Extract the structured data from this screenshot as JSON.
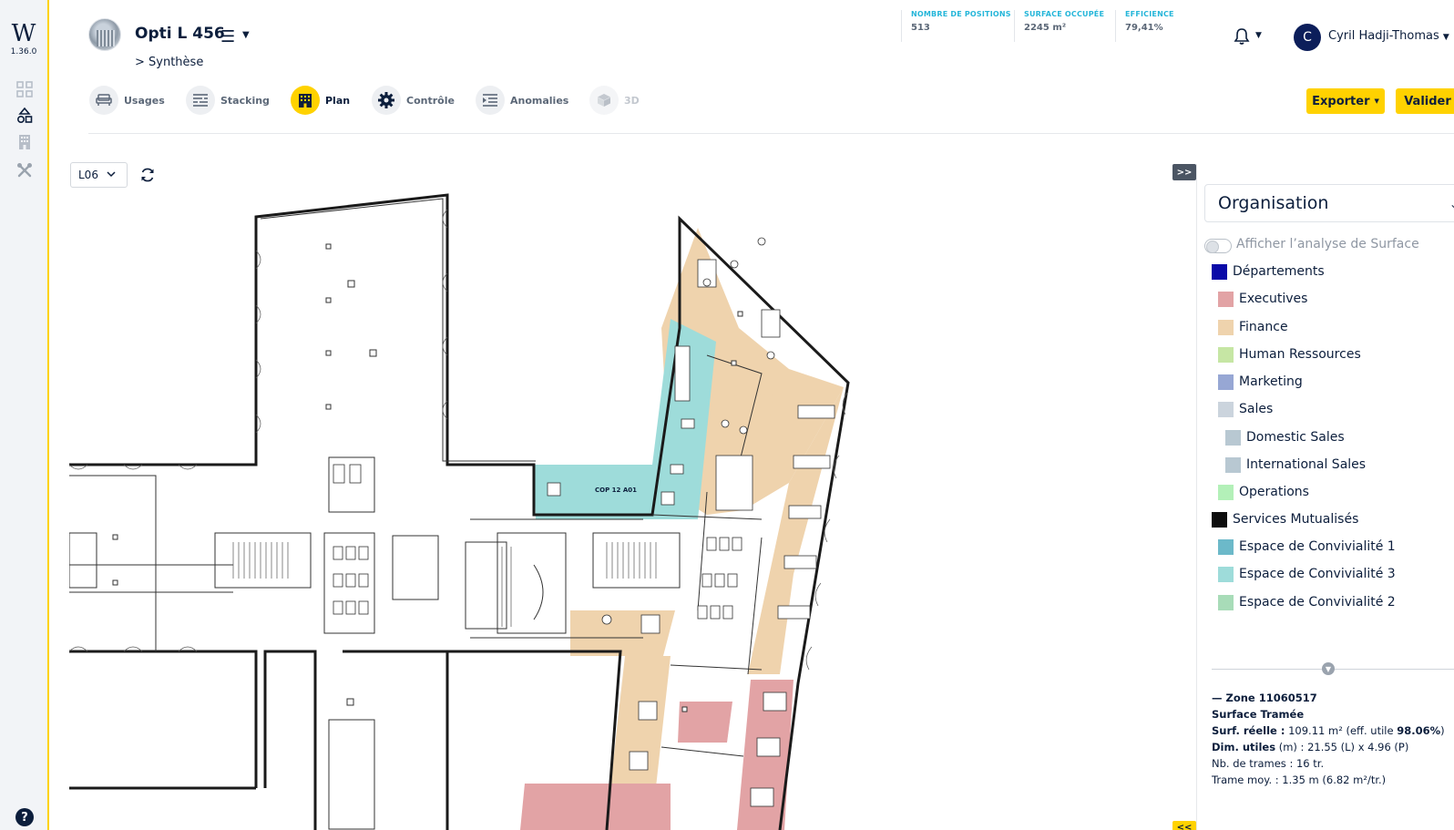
{
  "app": {
    "logo_letter": "W",
    "version": "1.36.0",
    "help_label": "?"
  },
  "project": {
    "title": "Opti L 456",
    "breadcrumb": "> Synthèse"
  },
  "kpis": [
    {
      "label": "NOMBRE DE POSITIONS",
      "value": "513"
    },
    {
      "label": "SURFACE OCCUPÉE",
      "value": "2245 m²"
    },
    {
      "label": "EFFICIENCE",
      "value": "79,41%"
    }
  ],
  "user": {
    "initial": "C",
    "name": "Cyril Hadji-Thomas"
  },
  "tabs": [
    {
      "label": "Usages",
      "icon": "sofa-icon"
    },
    {
      "label": "Stacking",
      "icon": "stacking-icon"
    },
    {
      "label": "Plan",
      "icon": "building-icon"
    },
    {
      "label": "Contrôle",
      "icon": "gear-icon"
    },
    {
      "label": "Anomalies",
      "icon": "list-indent-icon"
    },
    {
      "label": "3D",
      "icon": "cube-icon"
    }
  ],
  "actions": {
    "export_label": "Exporter",
    "validate_label": "Valider"
  },
  "floor": {
    "selected": "L06"
  },
  "plan": {
    "room_label": "COP 12 A01"
  },
  "panel": {
    "collapse_right": ">>",
    "collapse_bottom": "<<",
    "organisation": "Organisation",
    "toggle_label": "Afficher l’analyse de Surface",
    "legend": [
      {
        "label": "Départements",
        "color": "#0a0aa8"
      },
      {
        "label": "Executives",
        "color": "#e2a3a5"
      },
      {
        "label": "Finance",
        "color": "#efd3ad"
      },
      {
        "label": "Human Ressources",
        "color": "#c6e6a4"
      },
      {
        "label": "Marketing",
        "color": "#97a7d4"
      },
      {
        "label": "Sales",
        "color": "#cbd4dd"
      },
      {
        "label": "Domestic Sales",
        "color": "#b8c8d2"
      },
      {
        "label": "International Sales",
        "color": "#b8c8d2"
      },
      {
        "label": "Operations",
        "color": "#b3f0b8"
      },
      {
        "label": "Services Mutualisés",
        "color": "#0d0d0d"
      },
      {
        "label": "Espace de Convivialité 1",
        "color": "#6cb9c9"
      },
      {
        "label": "Espace de Convivialité 3",
        "color": "#9edcda"
      },
      {
        "label": "Espace de Convivialité 2",
        "color": "#a8dcb8"
      }
    ],
    "zone": {
      "title": "— Zone 11060517",
      "subtitle": "Surface Tramée",
      "surf_label": "Surf. réelle :",
      "surf_value": " 109.11 m²",
      "eff_prefix": " (eff. utile ",
      "eff_value": "98.06%",
      "eff_suffix": ")",
      "dim_label": "Dim. utiles",
      "dim_value": " (m) : 21.55 (L) x 4.96 (P)",
      "trames": "Nb. de trames : 16 tr.",
      "trame_moy": "Trame moy. : 1.35 m (6.82 m²/tr.)"
    }
  }
}
